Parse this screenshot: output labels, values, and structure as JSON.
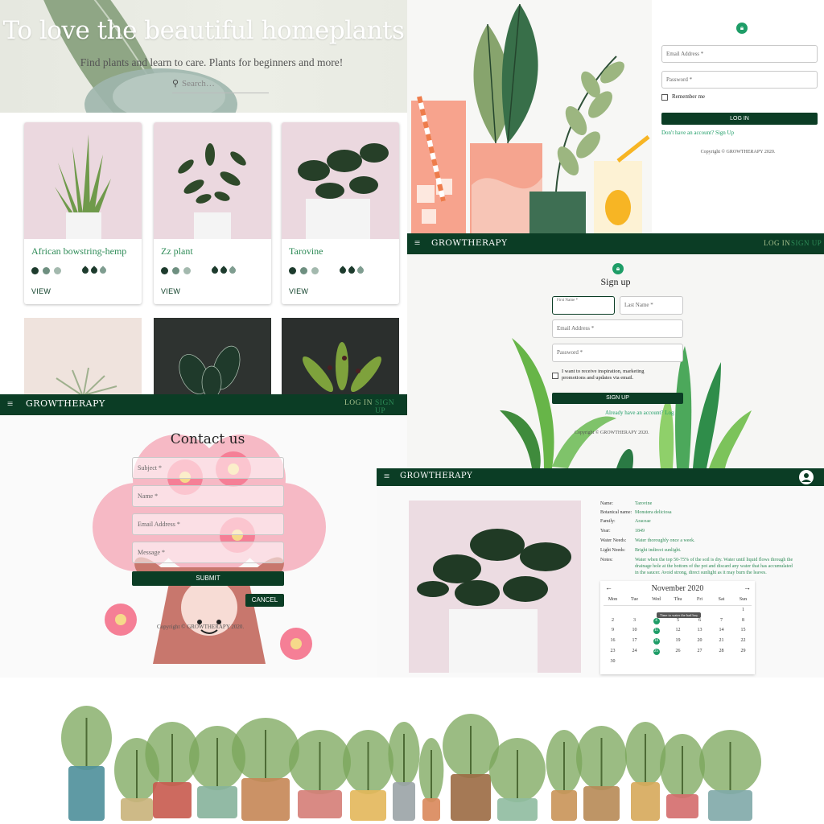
{
  "home": {
    "title": "To love the beautiful homeplants",
    "subtitle": "Find plants and learn to care. Plants for beginners and more!",
    "search_placeholder": "Search…",
    "cards": [
      {
        "name": "African bowstring-hemp",
        "view": "VIEW"
      },
      {
        "name": "Zz plant",
        "view": "VIEW"
      },
      {
        "name": "Tarovine",
        "view": "VIEW"
      }
    ]
  },
  "login": {
    "email_label": "Email Address *",
    "password_label": "Password *",
    "remember": "Remember me",
    "login_button": "LOG IN",
    "signup_link": "Don't have an account? Sign Up",
    "copyright": "Copyright © GROWTHERAPY 2020."
  },
  "appbar": {
    "brand": "GROWTHERAPY",
    "login": "LOG IN",
    "signup": "SIGN UP"
  },
  "signup": {
    "title": "Sign up",
    "first_name": "First Name *",
    "last_name": "Last Name *",
    "email": "Email Address *",
    "password": "Password *",
    "marketing": "I want to receive inspiration, marketing promotions and updates via email.",
    "button": "SIGN UP",
    "signin_link": "Already have an account? Log",
    "copyright": "Copyright © GROWTHERAPY 2020."
  },
  "contact": {
    "title": "Contact us",
    "subject": "Subject *",
    "name": "Name *",
    "email": "Email Address *",
    "message": "Message *",
    "submit": "SUBMIT",
    "cancel": "CANCEL",
    "copyright": "Copyright © GROWTHERAPY 2020."
  },
  "detail": {
    "rows": [
      {
        "k": "Name:",
        "v": "Tarovine"
      },
      {
        "k": "Botanical name:",
        "v": "Monstera deliciosa"
      },
      {
        "k": "Family:",
        "v": "Araceae"
      },
      {
        "k": "Year:",
        "v": "1849"
      },
      {
        "k": "Water Needs:",
        "v": "Water thoroughly once a week."
      },
      {
        "k": "Light Needs:",
        "v": "Bright indirect sunlight."
      },
      {
        "k": "Notes:",
        "v": "Water when the top 50-75% of the soil is dry. Water until liquid flows through the drainage hole at the bottom of the pot and discard any water that has accumulated in the saucer. Avoid strong, direct sunlight as it may burn the leaves."
      }
    ],
    "calendar": {
      "month": "November 2020",
      "prev": "←",
      "next": "→",
      "weekdays": [
        "Mon",
        "Tue",
        "Wed",
        "Thu",
        "Fri",
        "Sat",
        "Sun"
      ],
      "tooltip": "Time to water the bad boy",
      "weeks": [
        [
          "",
          "",
          "",
          "",
          "",
          "",
          "1"
        ],
        [
          "2",
          "3",
          "4",
          "5",
          "6",
          "7",
          "8"
        ],
        [
          "9",
          "10",
          "11",
          "12",
          "13",
          "14",
          "15"
        ],
        [
          "16",
          "17",
          "18",
          "19",
          "20",
          "21",
          "22"
        ],
        [
          "23",
          "24",
          "25",
          "26",
          "27",
          "28",
          "29"
        ],
        [
          "30",
          "",
          "",
          "",
          "",
          "",
          ""
        ]
      ],
      "highlighted": [
        "4",
        "11",
        "18",
        "25"
      ]
    }
  },
  "colors": {
    "primary": "#0b3d25",
    "accent": "#2e8b57",
    "link": "#1e9d67"
  }
}
